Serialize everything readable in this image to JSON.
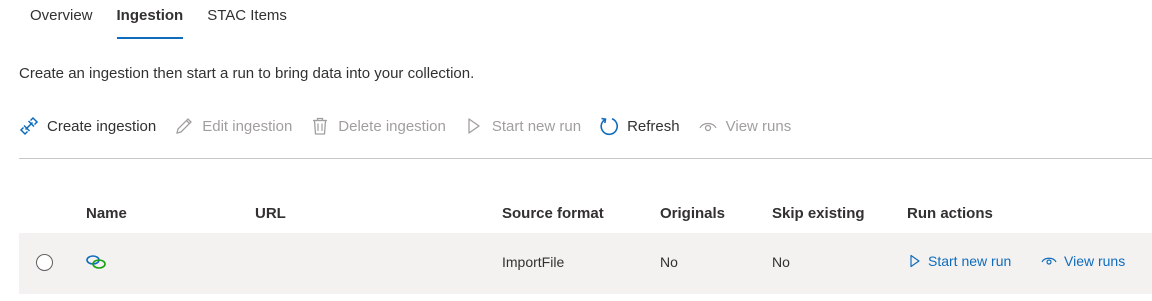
{
  "tabs": [
    {
      "label": "Overview",
      "active": false
    },
    {
      "label": "Ingestion",
      "active": true
    },
    {
      "label": "STAC Items",
      "active": false
    }
  ],
  "intro_text": "Create an ingestion then start a run to bring data into your collection.",
  "toolbar": {
    "create": {
      "label": "Create ingestion",
      "icon": "link-icon",
      "enabled": true
    },
    "edit": {
      "label": "Edit ingestion",
      "icon": "pencil-icon",
      "enabled": false
    },
    "delete": {
      "label": "Delete ingestion",
      "icon": "trash-icon",
      "enabled": false
    },
    "start": {
      "label": "Start new run",
      "icon": "play-icon",
      "enabled": false
    },
    "refresh": {
      "label": "Refresh",
      "icon": "refresh-icon",
      "enabled": true
    },
    "view": {
      "label": "View runs",
      "icon": "eye-icon",
      "enabled": false
    }
  },
  "table": {
    "columns": {
      "name": "Name",
      "url": "URL",
      "source_format": "Source format",
      "originals": "Originals",
      "skip_existing": "Skip existing",
      "run_actions": "Run actions"
    },
    "rows": [
      {
        "name_icon": "link-icon",
        "url": "",
        "source_format": "ImportFile",
        "originals": "No",
        "skip_existing": "No",
        "start_run_label": "Start new run",
        "view_runs_label": "View runs"
      }
    ]
  },
  "colors": {
    "accent": "#0f6cbd",
    "disabled_text": "#a19f9d",
    "row_background": "#f3f2f1",
    "link_icon_green": "#13a10e"
  }
}
